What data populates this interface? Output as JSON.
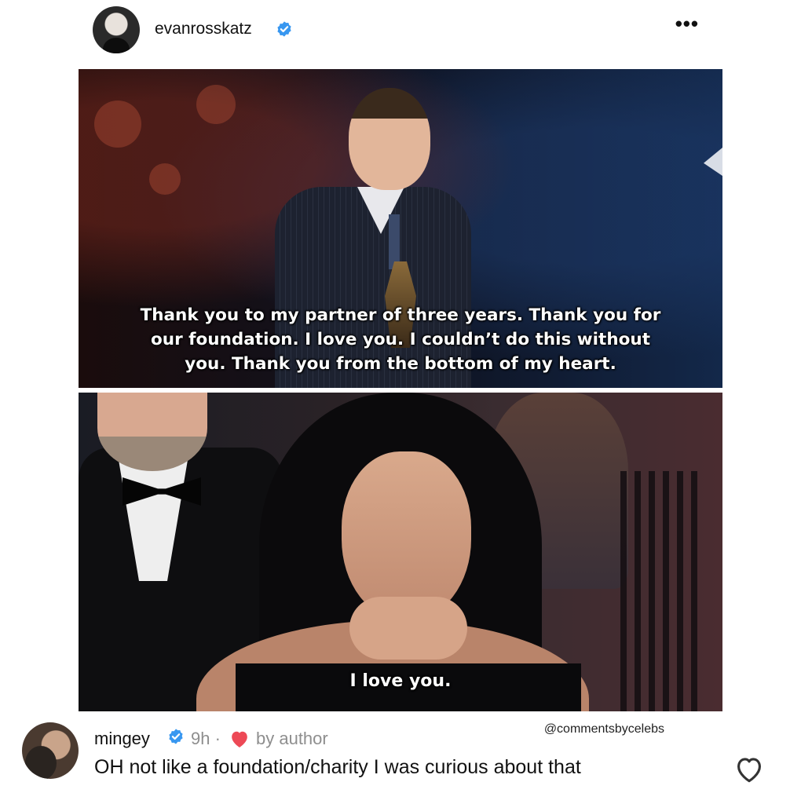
{
  "post": {
    "username": "evanrosskatz",
    "avatar_icon": "profile-avatar",
    "verified_icon": "verified-badge-icon",
    "more_icon": "more-options-icon",
    "more_label": "•••"
  },
  "media": {
    "top_caption_lines": [
      "Thank you to my partner of three years.  Thank you for",
      "our foundation. I love you. I couldn’t do this without",
      "you. Thank you from the bottom of my heart."
    ],
    "bottom_caption": "I love you."
  },
  "watermark": "@commentsbycelebs",
  "comment": {
    "username": "mingey",
    "time": "9h ·",
    "liked_by_author_label": "by author",
    "text": "OH not like a foundation/charity I was curious about that",
    "verified_icon": "verified-badge-icon",
    "author_heart_icon": "heart-filled-icon",
    "like_icon": "heart-outline-icon"
  },
  "colors": {
    "verified": "#3897f0",
    "heart": "#ed4956",
    "muted_text": "#8e8e8e"
  }
}
